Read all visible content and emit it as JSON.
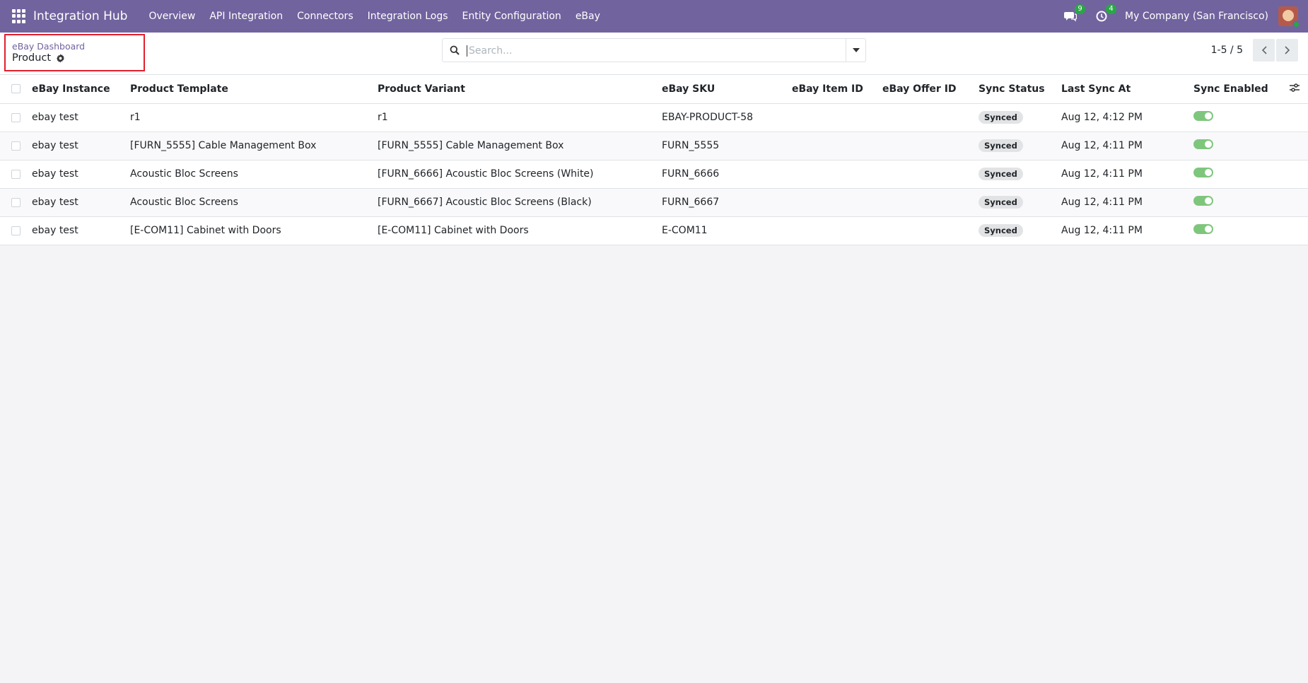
{
  "navbar": {
    "app_name": "Integration Hub",
    "menu": [
      "Overview",
      "API Integration",
      "Connectors",
      "Integration Logs",
      "Entity Configuration",
      "eBay"
    ],
    "messages_count": "9",
    "activities_count": "4",
    "company": "My Company (San Francisco)"
  },
  "breadcrumb": {
    "parent": "eBay Dashboard",
    "current": "Product"
  },
  "search": {
    "placeholder": "Search...",
    "value": ""
  },
  "pager": {
    "value": "1-5 / 5"
  },
  "table": {
    "columns": [
      "eBay Instance",
      "Product Template",
      "Product Variant",
      "eBay SKU",
      "eBay Item ID",
      "eBay Offer ID",
      "Sync Status",
      "Last Sync At",
      "Sync Enabled"
    ],
    "rows": [
      {
        "instance": "ebay test",
        "template": "r1",
        "variant": "r1",
        "sku": "EBAY-PRODUCT-58",
        "item_id": "",
        "offer_id": "",
        "status": "Synced",
        "last_sync": "Aug 12, 4:12 PM",
        "enabled": true
      },
      {
        "instance": "ebay test",
        "template": "[FURN_5555] Cable Management Box",
        "variant": "[FURN_5555] Cable Management Box",
        "sku": "FURN_5555",
        "item_id": "",
        "offer_id": "",
        "status": "Synced",
        "last_sync": "Aug 12, 4:11 PM",
        "enabled": true
      },
      {
        "instance": "ebay test",
        "template": "Acoustic Bloc Screens",
        "variant": "[FURN_6666] Acoustic Bloc Screens (White)",
        "sku": "FURN_6666",
        "item_id": "",
        "offer_id": "",
        "status": "Synced",
        "last_sync": "Aug 12, 4:11 PM",
        "enabled": true
      },
      {
        "instance": "ebay test",
        "template": "Acoustic Bloc Screens",
        "variant": "[FURN_6667] Acoustic Bloc Screens (Black)",
        "sku": "FURN_6667",
        "item_id": "",
        "offer_id": "",
        "status": "Synced",
        "last_sync": "Aug 12, 4:11 PM",
        "enabled": true
      },
      {
        "instance": "ebay test",
        "template": "[E-COM11] Cabinet with Doors",
        "variant": "[E-COM11] Cabinet with Doors",
        "sku": "E-COM11",
        "item_id": "",
        "offer_id": "",
        "status": "Synced",
        "last_sync": "Aug 12, 4:11 PM",
        "enabled": true
      }
    ]
  },
  "colors": {
    "brand": "#71639e",
    "toggle_on": "#7fc67d",
    "badge": "#28a745",
    "highlight_box": "#e0202c"
  }
}
